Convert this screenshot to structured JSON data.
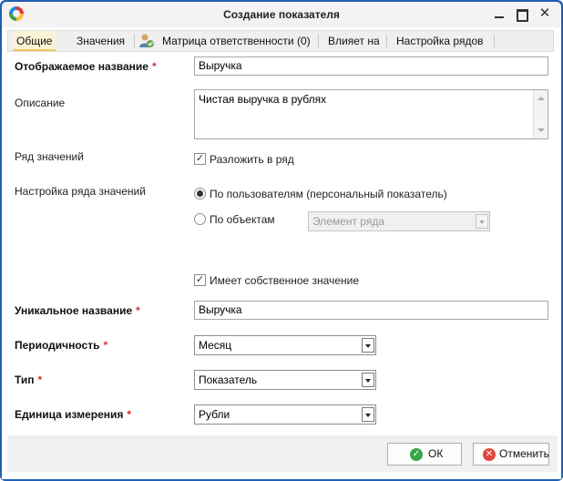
{
  "window": {
    "title": "Создание показателя"
  },
  "tabs": [
    {
      "label": "Общие"
    },
    {
      "label": "Значения"
    },
    {
      "label": "Матрица ответственности (0)"
    },
    {
      "label": "Влияет на"
    },
    {
      "label": "Настройка рядов"
    }
  ],
  "form": {
    "display_name": {
      "label": "Отображаемое название",
      "required_mark": "*",
      "value": "Выручка"
    },
    "description": {
      "label": "Описание",
      "value": "Чистая выручка в рублях"
    },
    "value_series": {
      "label": "Ряд значений",
      "checkbox_label": "Разложить в ряд",
      "checked": true
    },
    "series_setup": {
      "label": "Настройка ряда значений",
      "option_users": "По пользователям (персональный показатель)",
      "option_objects": "По объектам",
      "object_select_placeholder": "Элемент ряда",
      "selected": "users"
    },
    "own_value": {
      "checkbox_label": "Имеет собственное значение",
      "checked": true
    },
    "unique_name": {
      "label": "Уникальное название",
      "required_mark": "*",
      "value": "Выручка"
    },
    "periodicity": {
      "label": "Периодичность",
      "required_mark": "*",
      "value": "Месяц"
    },
    "type": {
      "label": "Тип",
      "required_mark": "*",
      "value": "Показатель"
    },
    "unit": {
      "label": "Единица измерения",
      "required_mark": "*",
      "value": "Рубли"
    }
  },
  "buttons": {
    "ok": "ОК",
    "cancel": "Отменить"
  },
  "icons": {
    "app": "app-logo-icon",
    "matrix_tab": "responsibility-matrix-icon",
    "ok": "check-circle-icon",
    "cancel": "cancel-circle-icon"
  },
  "colors": {
    "frame": "#1f5fb3",
    "active_tab": "#fbf3d5",
    "required": "#d32f2f",
    "ok_icon": "#3aa64a",
    "cancel_icon": "#e0473c"
  }
}
